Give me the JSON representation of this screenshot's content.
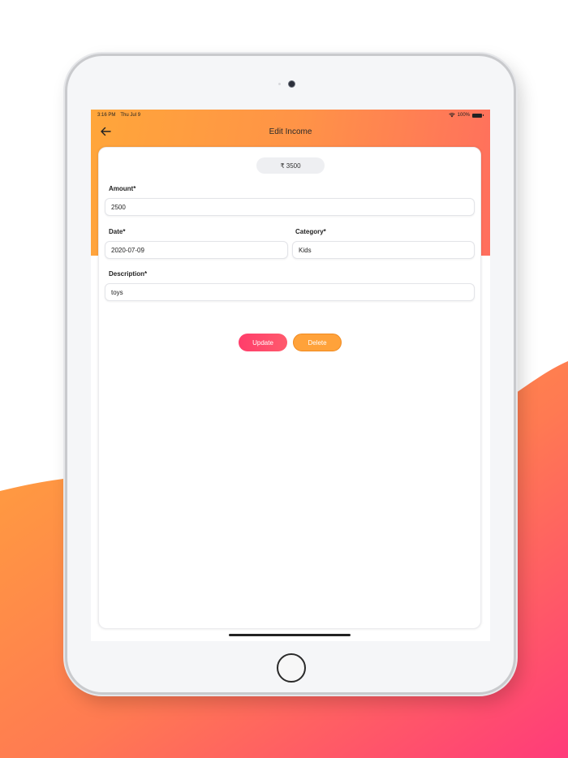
{
  "status_bar": {
    "time": "3:16 PM",
    "date": "Thu Jul 9",
    "battery": "100%"
  },
  "nav": {
    "title": "Edit Income",
    "back_icon": "arrow-left-icon"
  },
  "summary": {
    "total": "₹ 3500"
  },
  "form": {
    "amount": {
      "label": "Amount*",
      "value": "2500"
    },
    "date": {
      "label": "Date*",
      "value": "2020-07-09"
    },
    "category": {
      "label": "Category*",
      "value": "Kids"
    },
    "description": {
      "label": "Description*",
      "value": "toys"
    }
  },
  "actions": {
    "update_label": "Update",
    "delete_label": "Delete"
  },
  "colors": {
    "header_start": "#ffa63a",
    "header_end": "#ff6e5e",
    "update": "#ff3d6b",
    "delete": "#ffa23a"
  }
}
